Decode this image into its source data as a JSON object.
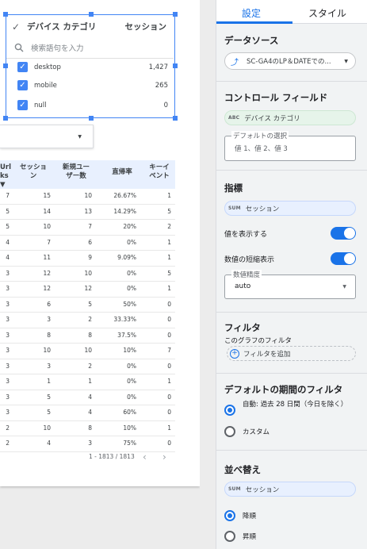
{
  "filter_control": {
    "header_label": "デバイス カテゴリ",
    "header_metric": "セッション",
    "search_placeholder": "検索語句を入力",
    "items": [
      {
        "label": "desktop",
        "value": "1,427"
      },
      {
        "label": "mobile",
        "value": "265"
      },
      {
        "label": "null",
        "value": "0"
      }
    ]
  },
  "table": {
    "headers": [
      "Url\nks\n▼",
      "セッショ\nン",
      "新規ユー\nザー数",
      "直帰率",
      "キーイ\nベント"
    ],
    "rows": [
      [
        "7",
        "15",
        "10",
        "26.67%",
        "1"
      ],
      [
        "5",
        "14",
        "13",
        "14.29%",
        "5"
      ],
      [
        "5",
        "10",
        "7",
        "20%",
        "2"
      ],
      [
        "4",
        "7",
        "6",
        "0%",
        "1"
      ],
      [
        "4",
        "11",
        "9",
        "9.09%",
        "1"
      ],
      [
        "3",
        "12",
        "10",
        "0%",
        "5"
      ],
      [
        "3",
        "12",
        "12",
        "0%",
        "1"
      ],
      [
        "3",
        "6",
        "5",
        "50%",
        "0"
      ],
      [
        "3",
        "3",
        "2",
        "33.33%",
        "0"
      ],
      [
        "3",
        "8",
        "8",
        "37.5%",
        "0"
      ],
      [
        "3",
        "10",
        "10",
        "10%",
        "7"
      ],
      [
        "3",
        "3",
        "2",
        "0%",
        "0"
      ],
      [
        "3",
        "1",
        "1",
        "0%",
        "1"
      ],
      [
        "3",
        "5",
        "4",
        "0%",
        "0"
      ],
      [
        "3",
        "5",
        "4",
        "60%",
        "0"
      ],
      [
        "2",
        "10",
        "8",
        "10%",
        "1"
      ],
      [
        "2",
        "4",
        "3",
        "75%",
        "0"
      ]
    ],
    "pagination": "1 - 1813 / 1813",
    "prev_icon": "‹",
    "next_icon": "›"
  },
  "panel": {
    "tabs": [
      "設定",
      "スタイル"
    ],
    "data_source": {
      "title": "データソース",
      "value": "SC-GA4のLP＆DATEでの..."
    },
    "control_field": {
      "title": "コントロール フィールド",
      "tag": "ABC",
      "field": "デバイス カテゴリ",
      "default_legend": "デフォルトの選択",
      "default_placeholder": "値 1、値 2、値 3"
    },
    "metric": {
      "title": "指標",
      "tag": "SUM",
      "field": "セッション",
      "show_values": "値を表示する",
      "compact": "数値の短縮表示",
      "precision_legend": "数値精度",
      "precision_value": "auto"
    },
    "filter": {
      "title": "フィルタ",
      "sub": "このグラフのフィルタ",
      "add": "フィルタを追加"
    },
    "date_filter": {
      "title": "デフォルトの期間のフィルタ",
      "auto": "自動: 過去 28 日間（今日を除く）",
      "custom": "カスタム"
    },
    "sort": {
      "title": "並べ替え",
      "tag": "SUM",
      "field": "セッション",
      "desc": "降順",
      "asc": "昇順"
    }
  },
  "colors": {
    "accent": "#1a73e8",
    "selection": "#4285f4"
  }
}
